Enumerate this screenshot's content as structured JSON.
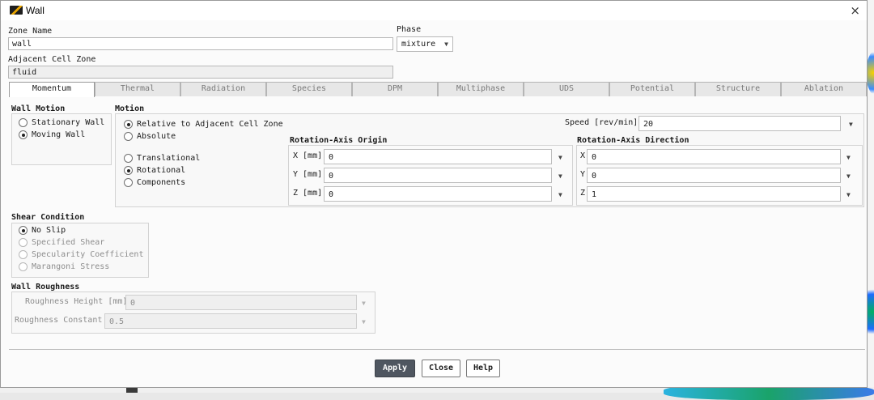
{
  "window": {
    "title": "Wall",
    "close_glyph": "×"
  },
  "zone_name": {
    "label": "Zone Name",
    "value": "wall"
  },
  "phase": {
    "label": "Phase",
    "value": "mixture"
  },
  "adjacent_cell_zone": {
    "label": "Adjacent Cell Zone",
    "value": "fluid"
  },
  "tabs": [
    {
      "label": "Momentum",
      "active": true
    },
    {
      "label": "Thermal"
    },
    {
      "label": "Radiation"
    },
    {
      "label": "Species"
    },
    {
      "label": "DPM"
    },
    {
      "label": "Multiphase"
    },
    {
      "label": "UDS"
    },
    {
      "label": "Potential"
    },
    {
      "label": "Structure"
    },
    {
      "label": "Ablation"
    }
  ],
  "wall_motion": {
    "title": "Wall Motion",
    "options": [
      {
        "label": "Stationary Wall",
        "selected": false
      },
      {
        "label": "Moving Wall",
        "selected": true
      }
    ]
  },
  "motion": {
    "title": "Motion",
    "reference": [
      {
        "label": "Relative to Adjacent Cell Zone",
        "selected": true
      },
      {
        "label": "Absolute",
        "selected": false
      }
    ],
    "type": [
      {
        "label": "Translational",
        "selected": false
      },
      {
        "label": "Rotational",
        "selected": true
      },
      {
        "label": "Components",
        "selected": false
      }
    ],
    "speed": {
      "label": "Speed [rev/min]",
      "value": "20"
    },
    "axis_origin": {
      "title": "Rotation-Axis Origin",
      "x": {
        "label": "X [mm]",
        "value": "0"
      },
      "y": {
        "label": "Y [mm]",
        "value": "0"
      },
      "z": {
        "label": "Z [mm]",
        "value": "0"
      }
    },
    "axis_direction": {
      "title": "Rotation-Axis Direction",
      "x": {
        "label": "X",
        "value": "0"
      },
      "y": {
        "label": "Y",
        "value": "0"
      },
      "z": {
        "label": "Z",
        "value": "1"
      }
    }
  },
  "shear_condition": {
    "title": "Shear Condition",
    "options": [
      {
        "label": "No Slip",
        "selected": true,
        "enabled": true
      },
      {
        "label": "Specified Shear",
        "selected": false,
        "enabled": false
      },
      {
        "label": "Specularity Coefficient",
        "selected": false,
        "enabled": false
      },
      {
        "label": "Marangoni Stress",
        "selected": false,
        "enabled": false
      }
    ]
  },
  "wall_roughness": {
    "title": "Wall Roughness",
    "height": {
      "label": "Roughness Height [mm]",
      "value": "0"
    },
    "constant": {
      "label": "Roughness Constant",
      "value": "0.5"
    }
  },
  "buttons": {
    "apply": "Apply",
    "close": "Close",
    "help": "Help"
  },
  "icons": {
    "dropdown": "▼"
  },
  "colors": {
    "apply_bg": "#4f5660"
  }
}
